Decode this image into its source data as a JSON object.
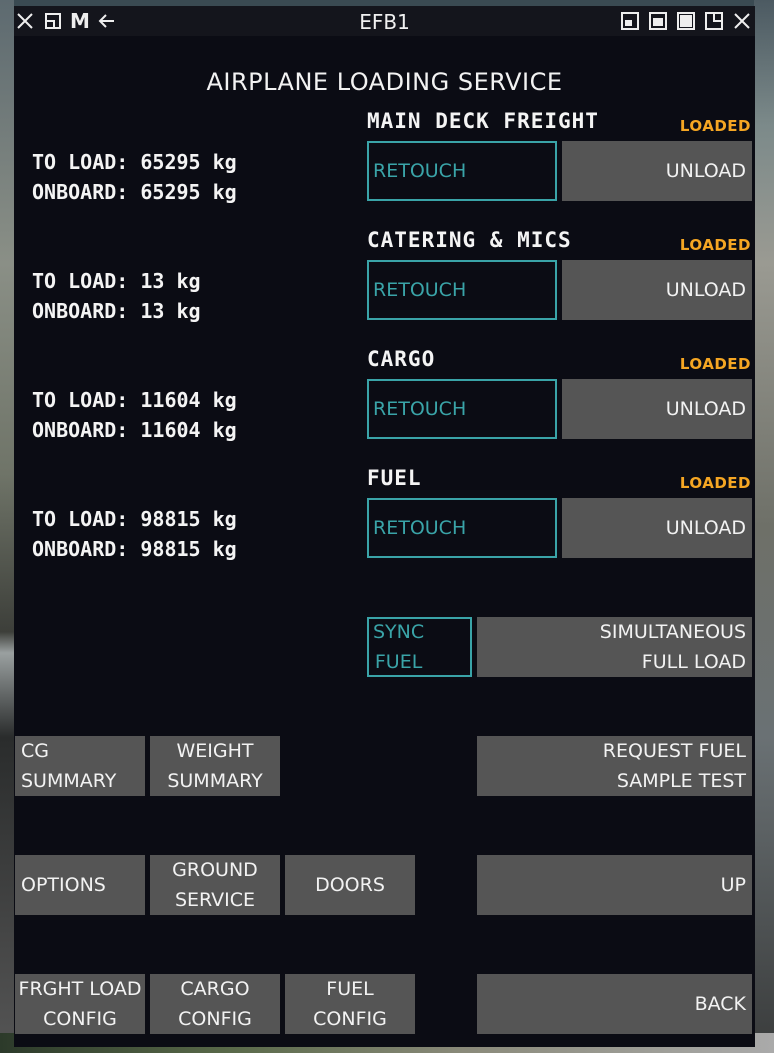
{
  "window": {
    "title": "EFB1",
    "m_label": "M"
  },
  "heading": "AIRPLANE LOADING SERVICE",
  "sections": [
    {
      "title": "MAIN DECK FREIGHT",
      "status": "LOADED",
      "to_load": "TO LOAD: 65295 kg",
      "onboard": "ONBOARD: 65295 kg",
      "retouch": "RETOUCH",
      "unload": "UNLOAD"
    },
    {
      "title": "CATERING & MICS",
      "status": "LOADED",
      "to_load": "TO LOAD: 13 kg",
      "onboard": "ONBOARD: 13 kg",
      "retouch": "RETOUCH",
      "unload": "UNLOAD"
    },
    {
      "title": "CARGO",
      "status": "LOADED",
      "to_load": "TO LOAD: 11604 kg",
      "onboard": "ONBOARD: 11604 kg",
      "retouch": "RETOUCH",
      "unload": "UNLOAD"
    },
    {
      "title": "FUEL",
      "status": "LOADED",
      "to_load": "TO LOAD: 98815 kg",
      "onboard": "ONBOARD: 98815 kg",
      "retouch": "RETOUCH",
      "unload": "UNLOAD"
    }
  ],
  "sync_fuel": {
    "line1": "SYNC",
    "line2": "FUEL"
  },
  "simultaneous": {
    "line1": "SIMULTANEOUS",
    "line2": "FULL LOAD"
  },
  "cg_summary": {
    "line1": "CG",
    "line2": "SUMMARY"
  },
  "weight_summary": {
    "line1": "WEIGHT",
    "line2": "SUMMARY"
  },
  "request_fuel": {
    "line1": "REQUEST FUEL",
    "line2": "SAMPLE TEST"
  },
  "options": "OPTIONS",
  "ground_service": {
    "line1": "GROUND",
    "line2": "SERVICE"
  },
  "doors": "DOORS",
  "up": "UP",
  "frght_load": {
    "line1": "FRGHT LOAD",
    "line2": "CONFIG"
  },
  "cargo_config": {
    "line1": "CARGO",
    "line2": "CONFIG"
  },
  "fuel_config": {
    "line1": "FUEL",
    "line2": "CONFIG"
  },
  "back": "BACK",
  "colors": {
    "accent": "#3aa4a8",
    "status": "#f5a623",
    "button": "#555555",
    "panel": "#0b0c14"
  }
}
